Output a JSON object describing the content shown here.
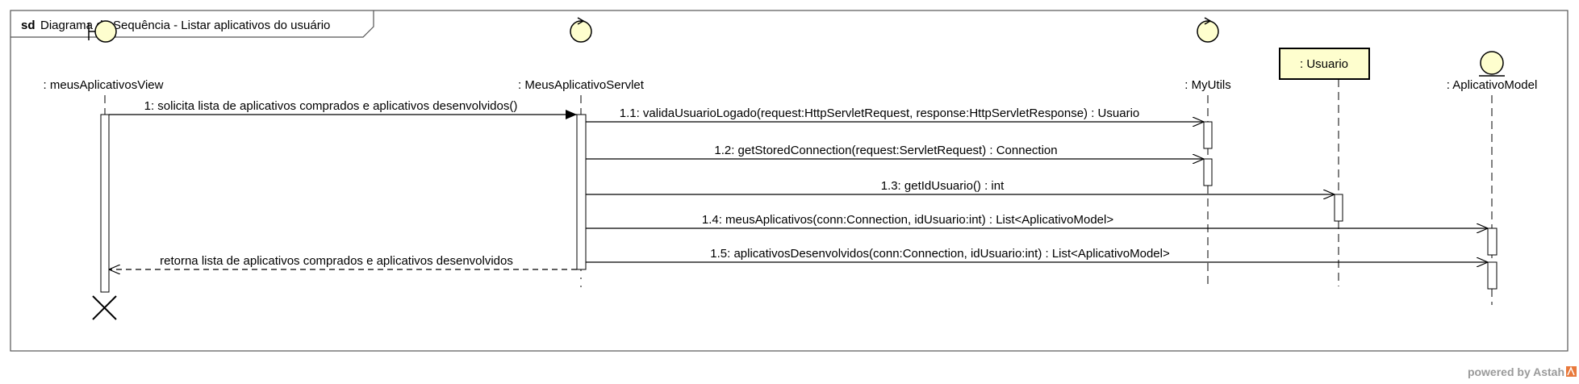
{
  "frame": {
    "keyword": "sd",
    "title": "Diagrama de Sequência - Listar aplicativos do usuário"
  },
  "lifelines": [
    {
      "id": "view",
      "label": ": meusAplicativosView",
      "stereotype": "boundary-icon"
    },
    {
      "id": "servlet",
      "label": ": MeusAplicativoServlet",
      "stereotype": "control-icon"
    },
    {
      "id": "utils",
      "label": ": MyUtils",
      "stereotype": "control-icon"
    },
    {
      "id": "usuario",
      "label": ": Usuario",
      "stereotype": "class-box"
    },
    {
      "id": "model",
      "label": ": AplicativoModel",
      "stereotype": "entity-icon"
    }
  ],
  "messages": [
    {
      "id": "m1",
      "label": "1: solicita lista de aplicativos comprados e aplicativos desenvolvidos()",
      "from": "view",
      "to": "servlet",
      "kind": "sync"
    },
    {
      "id": "m1_1",
      "label": "1.1: validaUsuarioLogado(request:HttpServletRequest, response:HttpServletResponse) : Usuario",
      "from": "servlet",
      "to": "utils",
      "kind": "call"
    },
    {
      "id": "m1_2",
      "label": "1.2: getStoredConnection(request:ServletRequest) : Connection",
      "from": "servlet",
      "to": "utils",
      "kind": "call"
    },
    {
      "id": "m1_3",
      "label": "1.3: getIdUsuario() : int",
      "from": "servlet",
      "to": "usuario",
      "kind": "call"
    },
    {
      "id": "m1_4",
      "label": "1.4: meusAplicativos(conn:Connection, idUsuario:int) : List<AplicativoModel>",
      "from": "servlet",
      "to": "model",
      "kind": "call"
    },
    {
      "id": "m1_5",
      "label": "1.5: aplicativosDesenvolvidos(conn:Connection, idUsuario:int) : List<AplicativoModel>",
      "from": "servlet",
      "to": "model",
      "kind": "call"
    },
    {
      "id": "r1",
      "label": "retorna lista de aplicativos comprados e aplicativos desenvolvidos",
      "from": "servlet",
      "to": "view",
      "kind": "return"
    }
  ],
  "watermark": "powered by Astah",
  "colors": {
    "element_fill": "#fefece",
    "stroke": "#000000",
    "frame_stroke": "#555555",
    "watermark_icon": "#e8793c"
  }
}
